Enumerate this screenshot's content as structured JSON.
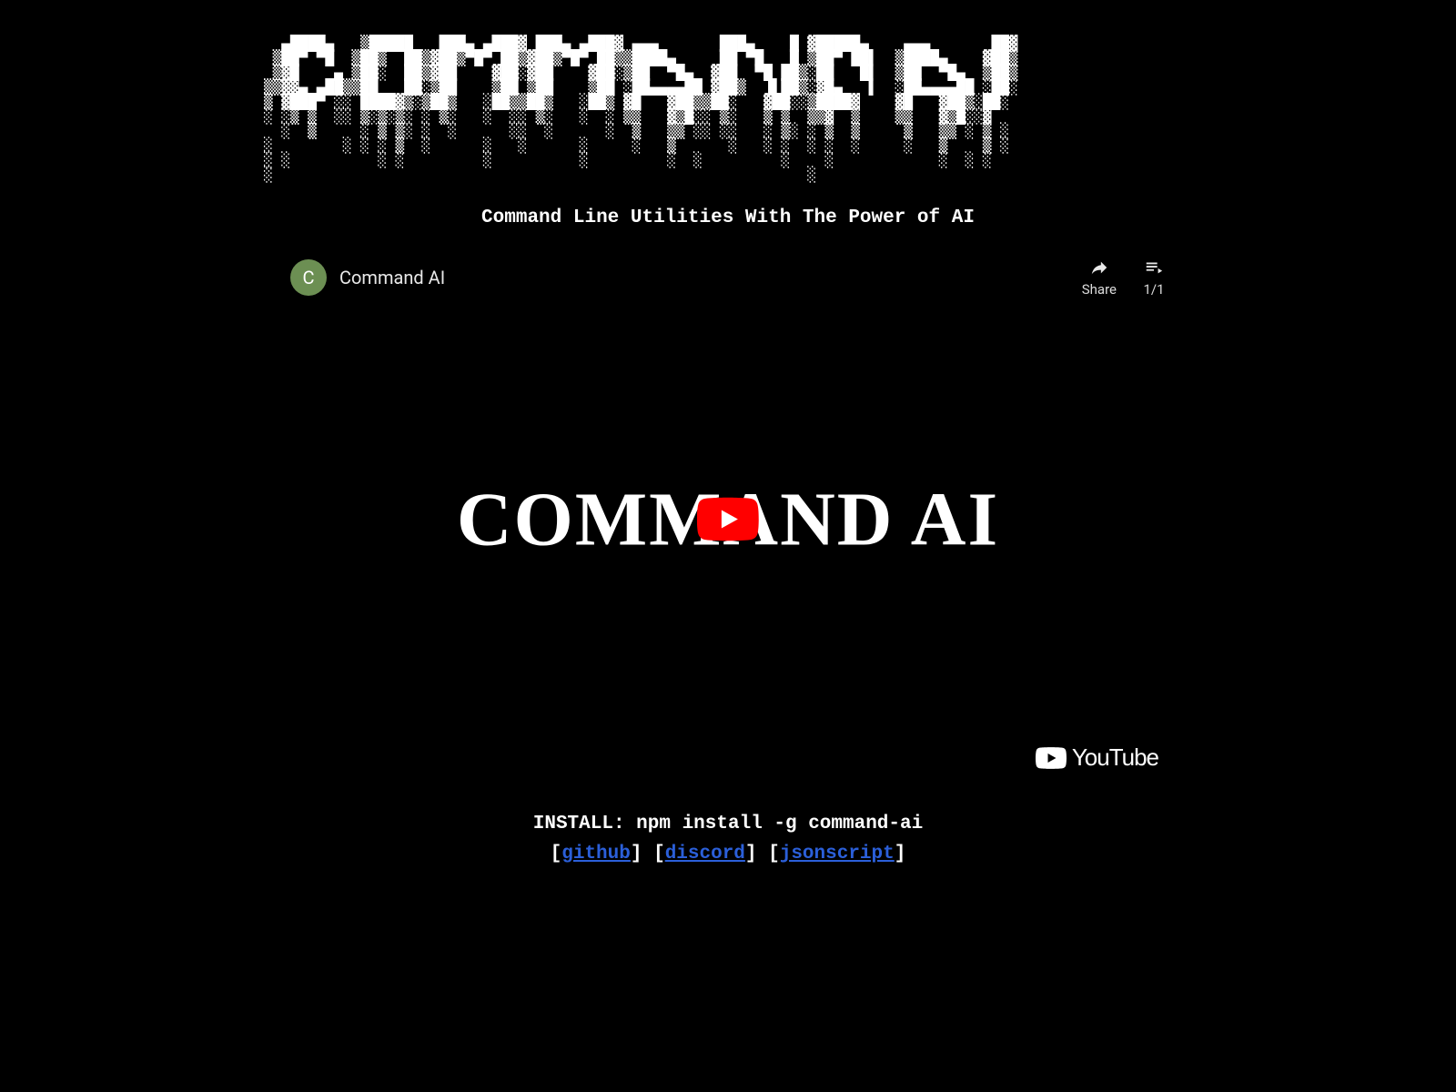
{
  "ascii_art": "  ▄████▄   ▒█████   ███▄ ▄███▓ ███▄ ▄███▓ ▄▄▄       ███▄    █ ▓█████▄    ▄▄▄       ██▓\n ▒██▀ ▀█  ▒██▒  ██▒▓██▒▀█▀ ██▒▓██▒▀█▀ ██▒▒████▄     ██ ▀█   █ ▒██▀ ██▌  ▒████▄    ▓██▒\n ▒▓█    ▄ ▒██░  ██▒▓██    ▓██░▓██    ▓██░▒██  ▀█▄  ▓██  ▀█ ██▒░██   █▌  ▒██  ▀█▄  ▒██▒\n▒▒▓▓▄ ▄██▒▒██   ██░▒██    ▒██ ▒██    ▒██ ░██▄▄▄▄██ ▓██▒  ▐▌██▒░▓█▄   ▌  ░██▄▄▄▄██ ░██░\n▒ ▓███▀ ░░ ████▓▒░▒██▒   ░██▒▒██▒   ░██▒ ▓█   ▓██▒▒██░   ▓██░░▒████▓    ▓█   ▓██▒░██░\n░ ░▒ ▒  ░░ ▒░▒░▒░ ░ ▒░   ░  ░░ ▒░   ░  ░ ▒▒   ▓▒█░░ ▒░   ▒ ▒  ▒▒▓  ▒    ▒▒   ▓▒█░░▓  \n  ░  ▒     ░ ▒ ▒░ ░  ░      ░░  ░      ░  ▒   ▒▒ ░░ ░░   ░ ▒░ ░ ▒  ▒     ▒   ▒▒ ░ ▒ ░\n░        ░ ░ ░ ▒  ░      ░   ░      ░     ░   ▒      ░   ░ ░  ░ ░  ░     ░   ▒    ▒ ░\n░ ░          ░ ░         ░          ░         ░  ░         ░    ░            ░  ░ ░  \n░                                                             ░                      ",
  "subtitle": "Command Line Utilities With The Power of AI",
  "video": {
    "avatar_letter": "C",
    "title": "Command AI",
    "share_label": "Share",
    "playlist_label": "1/1",
    "center_text": "COMMAND AI",
    "platform": "YouTube"
  },
  "install": "INSTALL: npm install -g command-ai",
  "links": {
    "github": "github",
    "discord": "discord",
    "jsonscript": "jsonscript"
  }
}
